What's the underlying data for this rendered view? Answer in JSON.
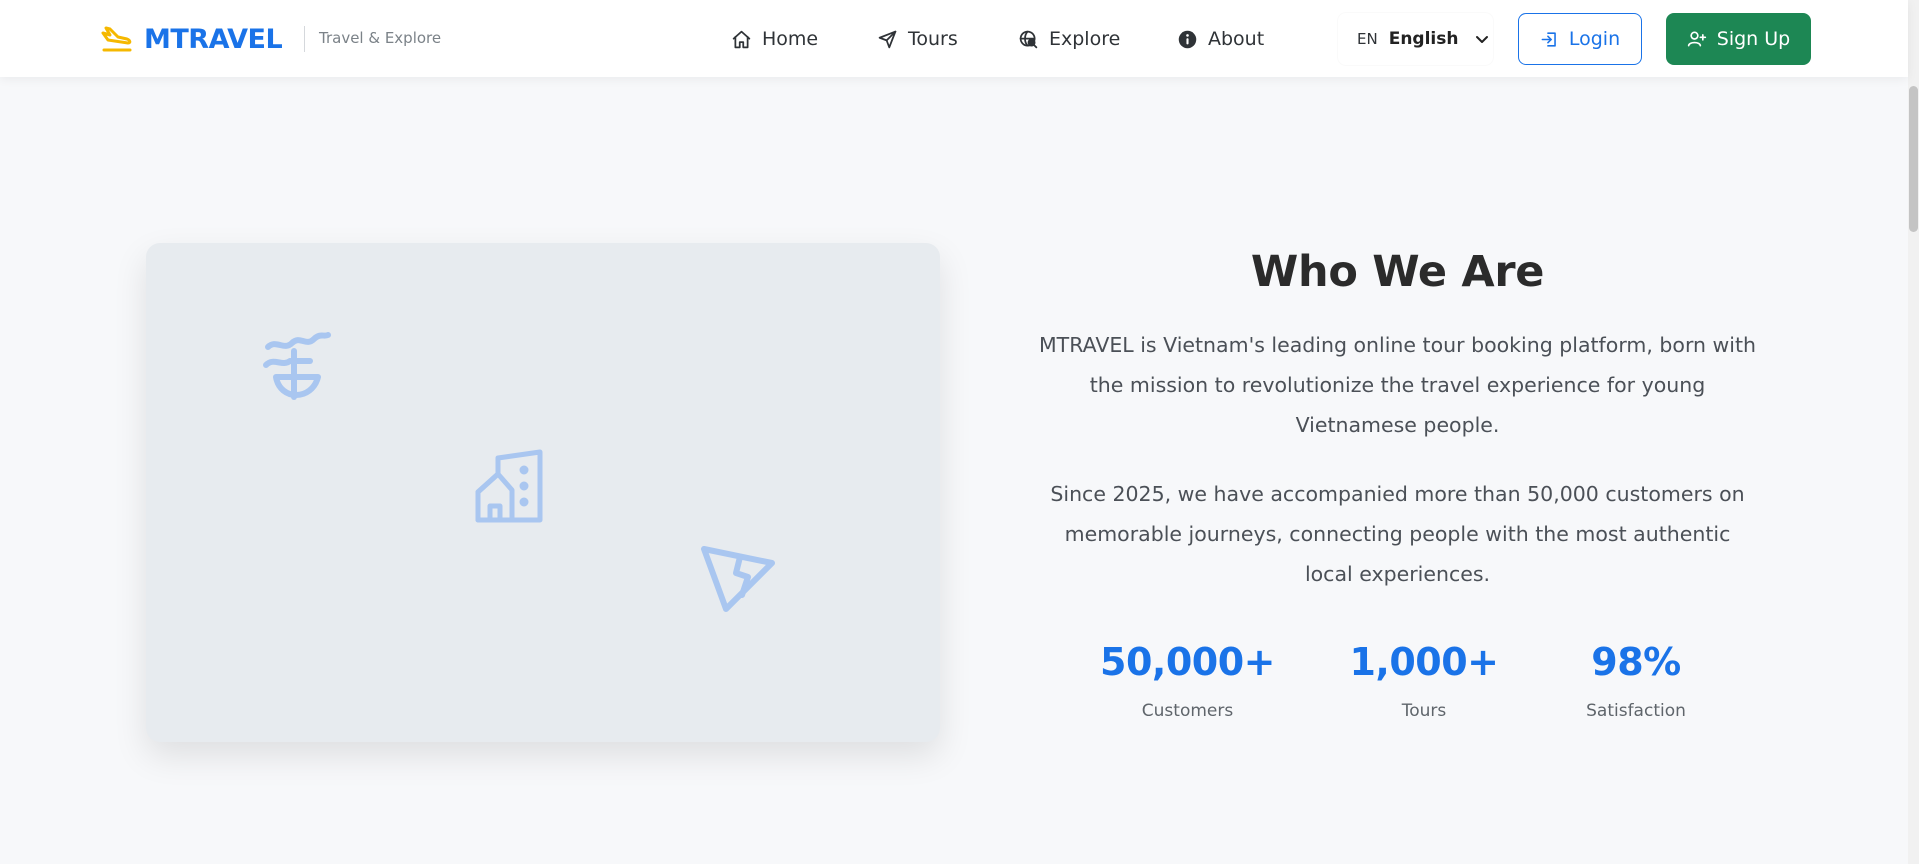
{
  "brand": {
    "name": "MTRAVEL",
    "tagline": "Travel & Explore",
    "logo_icon": "plane-landing-icon",
    "logo_color": "#f5b800",
    "name_color": "#1a73e8"
  },
  "nav": {
    "items": [
      {
        "label": "Home",
        "icon": "home-icon"
      },
      {
        "label": "Tours",
        "icon": "send-icon"
      },
      {
        "label": "Explore",
        "icon": "globe-search-icon"
      },
      {
        "label": "About",
        "icon": "info-icon"
      }
    ]
  },
  "language": {
    "code": "EN",
    "label": "English",
    "icon": "chevron-down-icon"
  },
  "auth": {
    "login_label": "Login",
    "signup_label": "Sign Up",
    "login_color": "#1a73e8",
    "signup_color": "#1d8754"
  },
  "about": {
    "title": "Who We Are",
    "paragraph1": "MTRAVEL is Vietnam's leading online tour booking platform, born with the mission to revolutionize the travel experience for young Vietnamese people.",
    "paragraph2": "Since 2025, we have accompanied more than 50,000 customers on memorable journeys, connecting people with the most authentic local experiences.",
    "stats": [
      {
        "value": "50,000+",
        "label": "Customers"
      },
      {
        "value": "1,000+",
        "label": "Tours"
      },
      {
        "value": "98%",
        "label": "Satisfaction"
      }
    ]
  },
  "image_card": {
    "icons": [
      "sailboat-icon",
      "building-icon",
      "paper-plane-icon"
    ],
    "icon_color": "#a9c6f0"
  }
}
